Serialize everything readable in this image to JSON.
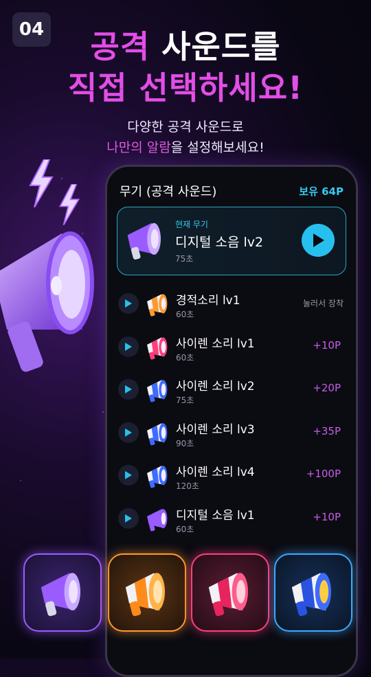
{
  "badge": "04",
  "headline": {
    "line1_accent": "공격",
    "line1_rest": " 사운드를",
    "line2": "직접 선택하세요!"
  },
  "subtitle": {
    "line1": "다양한 공격 사운드로",
    "line2_highlight": "나만의 알람",
    "line2_rest": "을 설정해보세요!"
  },
  "phone": {
    "title": "무기 (공격 사운드)",
    "points": "보유  64P",
    "current": {
      "label": "현재 무기",
      "name": "디지털 소음 lv2",
      "duration": "75초",
      "icon": "megaphone-purple-icon"
    },
    "list": [
      {
        "name": "경적소리 lv1",
        "duration": "60초",
        "action": "눌러서 장착",
        "icon": "megaphone-orange-icon",
        "color": "#ff9a2e"
      },
      {
        "name": "사이렌 소리 lv1",
        "duration": "60초",
        "price": "+10P",
        "icon": "megaphone-pink-icon",
        "color": "#ff3f7a"
      },
      {
        "name": "사이렌 소리 lv2",
        "duration": "75초",
        "price": "+20P",
        "icon": "megaphone-blue-icon",
        "color": "#3f6cff"
      },
      {
        "name": "사이렌 소리 lv3",
        "duration": "90초",
        "price": "+35P",
        "icon": "megaphone-blue-icon",
        "color": "#3f6cff"
      },
      {
        "name": "사이렌 소리 lv4",
        "duration": "120초",
        "price": "+100P",
        "icon": "megaphone-blue-icon",
        "color": "#3f6cff"
      },
      {
        "name": "디지털 소음 lv1",
        "duration": "60초",
        "price": "+10P",
        "icon": "megaphone-purple-icon",
        "color": "#9a5cff"
      }
    ]
  },
  "tiles": [
    {
      "icon": "megaphone-purple-icon",
      "color": "#9a5cff"
    },
    {
      "icon": "megaphone-orange-icon",
      "color": "#ff9a2e"
    },
    {
      "icon": "megaphone-pink-icon",
      "color": "#ff3f7a"
    },
    {
      "icon": "megaphone-blue-icon",
      "color": "#3f6cff"
    }
  ],
  "colors": {
    "accent_pink": "#e24ee6",
    "accent_cyan": "#37c8ee",
    "price_purple": "#c75ee8"
  }
}
